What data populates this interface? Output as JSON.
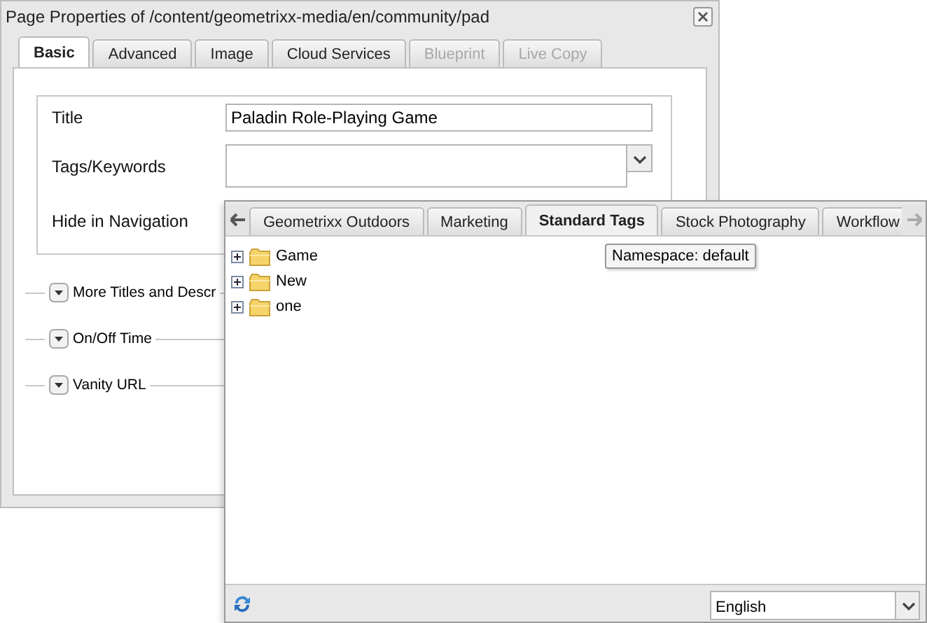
{
  "dialog": {
    "title": "Page Properties of /content/geometrixx-media/en/community/pad",
    "tabs": [
      {
        "label": "Basic",
        "selected": true,
        "disabled": false
      },
      {
        "label": "Advanced",
        "selected": false,
        "disabled": false
      },
      {
        "label": "Image",
        "selected": false,
        "disabled": false
      },
      {
        "label": "Cloud Services",
        "selected": false,
        "disabled": false
      },
      {
        "label": "Blueprint",
        "selected": false,
        "disabled": true
      },
      {
        "label": "Live Copy",
        "selected": false,
        "disabled": true
      }
    ],
    "fields": [
      {
        "kind": "text",
        "label": "Title",
        "value": "Paladin Role-Playing Game"
      },
      {
        "kind": "combo",
        "label": "Tags/Keywords"
      },
      {
        "kind": "check",
        "label": "Hide in Navigation"
      }
    ],
    "sections": [
      {
        "label": "More Titles and Descr"
      },
      {
        "label": "On/Off Time"
      },
      {
        "label": "Vanity URL"
      }
    ]
  },
  "tag_picker": {
    "tabs": [
      {
        "label": "Geometrixx Outdoors",
        "selected": false
      },
      {
        "label": "Marketing",
        "selected": false
      },
      {
        "label": "Standard Tags",
        "selected": true
      },
      {
        "label": "Stock Photography",
        "selected": false
      },
      {
        "label": "Workflow",
        "selected": false
      }
    ],
    "tooltip": "Namespace: default",
    "tree": [
      {
        "label": "Game",
        "expanded": false
      },
      {
        "label": "New",
        "expanded": false
      },
      {
        "label": "one",
        "expanded": false
      }
    ],
    "language": "English"
  }
}
